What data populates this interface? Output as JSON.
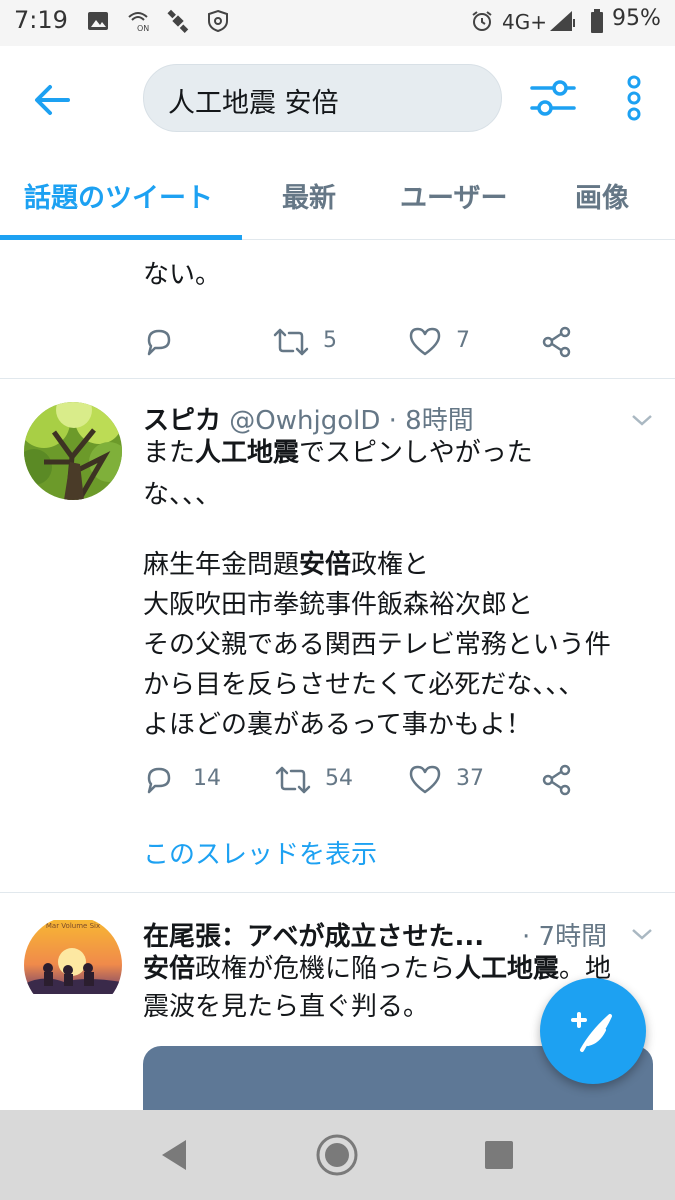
{
  "status_bar": {
    "time": "7:19",
    "network": "4G+",
    "battery": "95%",
    "icons": [
      "image-icon",
      "wifi-calling-icon",
      "satellite-icon",
      "vpn-shield-icon",
      "alarm-icon",
      "signal-icon",
      "battery-icon"
    ]
  },
  "header": {
    "search_value": "人工地震 安倍",
    "accent_color": "#1da1f2"
  },
  "tabs": [
    {
      "label": "話題のツイート",
      "active": true
    },
    {
      "label": "最新",
      "active": false
    },
    {
      "label": "ユーザー",
      "active": false
    },
    {
      "label": "画像",
      "active": false
    }
  ],
  "tweets": [
    {
      "partial_text_line": "ない。",
      "replies": "",
      "retweets": "5",
      "likes": "7"
    },
    {
      "name": "スピカ",
      "handle": "@OwhjgolD",
      "time": "· 8時間",
      "lines": [
        {
          "pre": "また",
          "bold": "人工地震",
          "post": "でスピンしやがった"
        },
        {
          "pre": "な、、、",
          "bold": "",
          "post": ""
        },
        {
          "pre": "麻生年金問題",
          "bold": "安倍",
          "post": "政権と"
        },
        {
          "pre": "大阪吹田市拳銃事件飯森裕次郎と",
          "bold": "",
          "post": ""
        },
        {
          "pre": "その父親である関西テレビ常務という件",
          "bold": "",
          "post": ""
        },
        {
          "pre": "から目を反らさせたくて必死だな、、、",
          "bold": "",
          "post": ""
        },
        {
          "pre": "よほどの裏があるって事かもよ！",
          "bold": "",
          "post": ""
        }
      ],
      "replies": "14",
      "retweets": "54",
      "likes": "37",
      "thread_link": "このスレッドを表示"
    },
    {
      "name": "在尾張：アベが成立させた...",
      "time": "· 7時間",
      "avatar_text": "Mar Volume Six",
      "line1": {
        "bold1": "安倍",
        "mid": "政権が危機に陥ったら",
        "bold2": "人工地震",
        "post": "。地"
      },
      "line2": "震波を見たら直ぐ判る。"
    }
  ]
}
